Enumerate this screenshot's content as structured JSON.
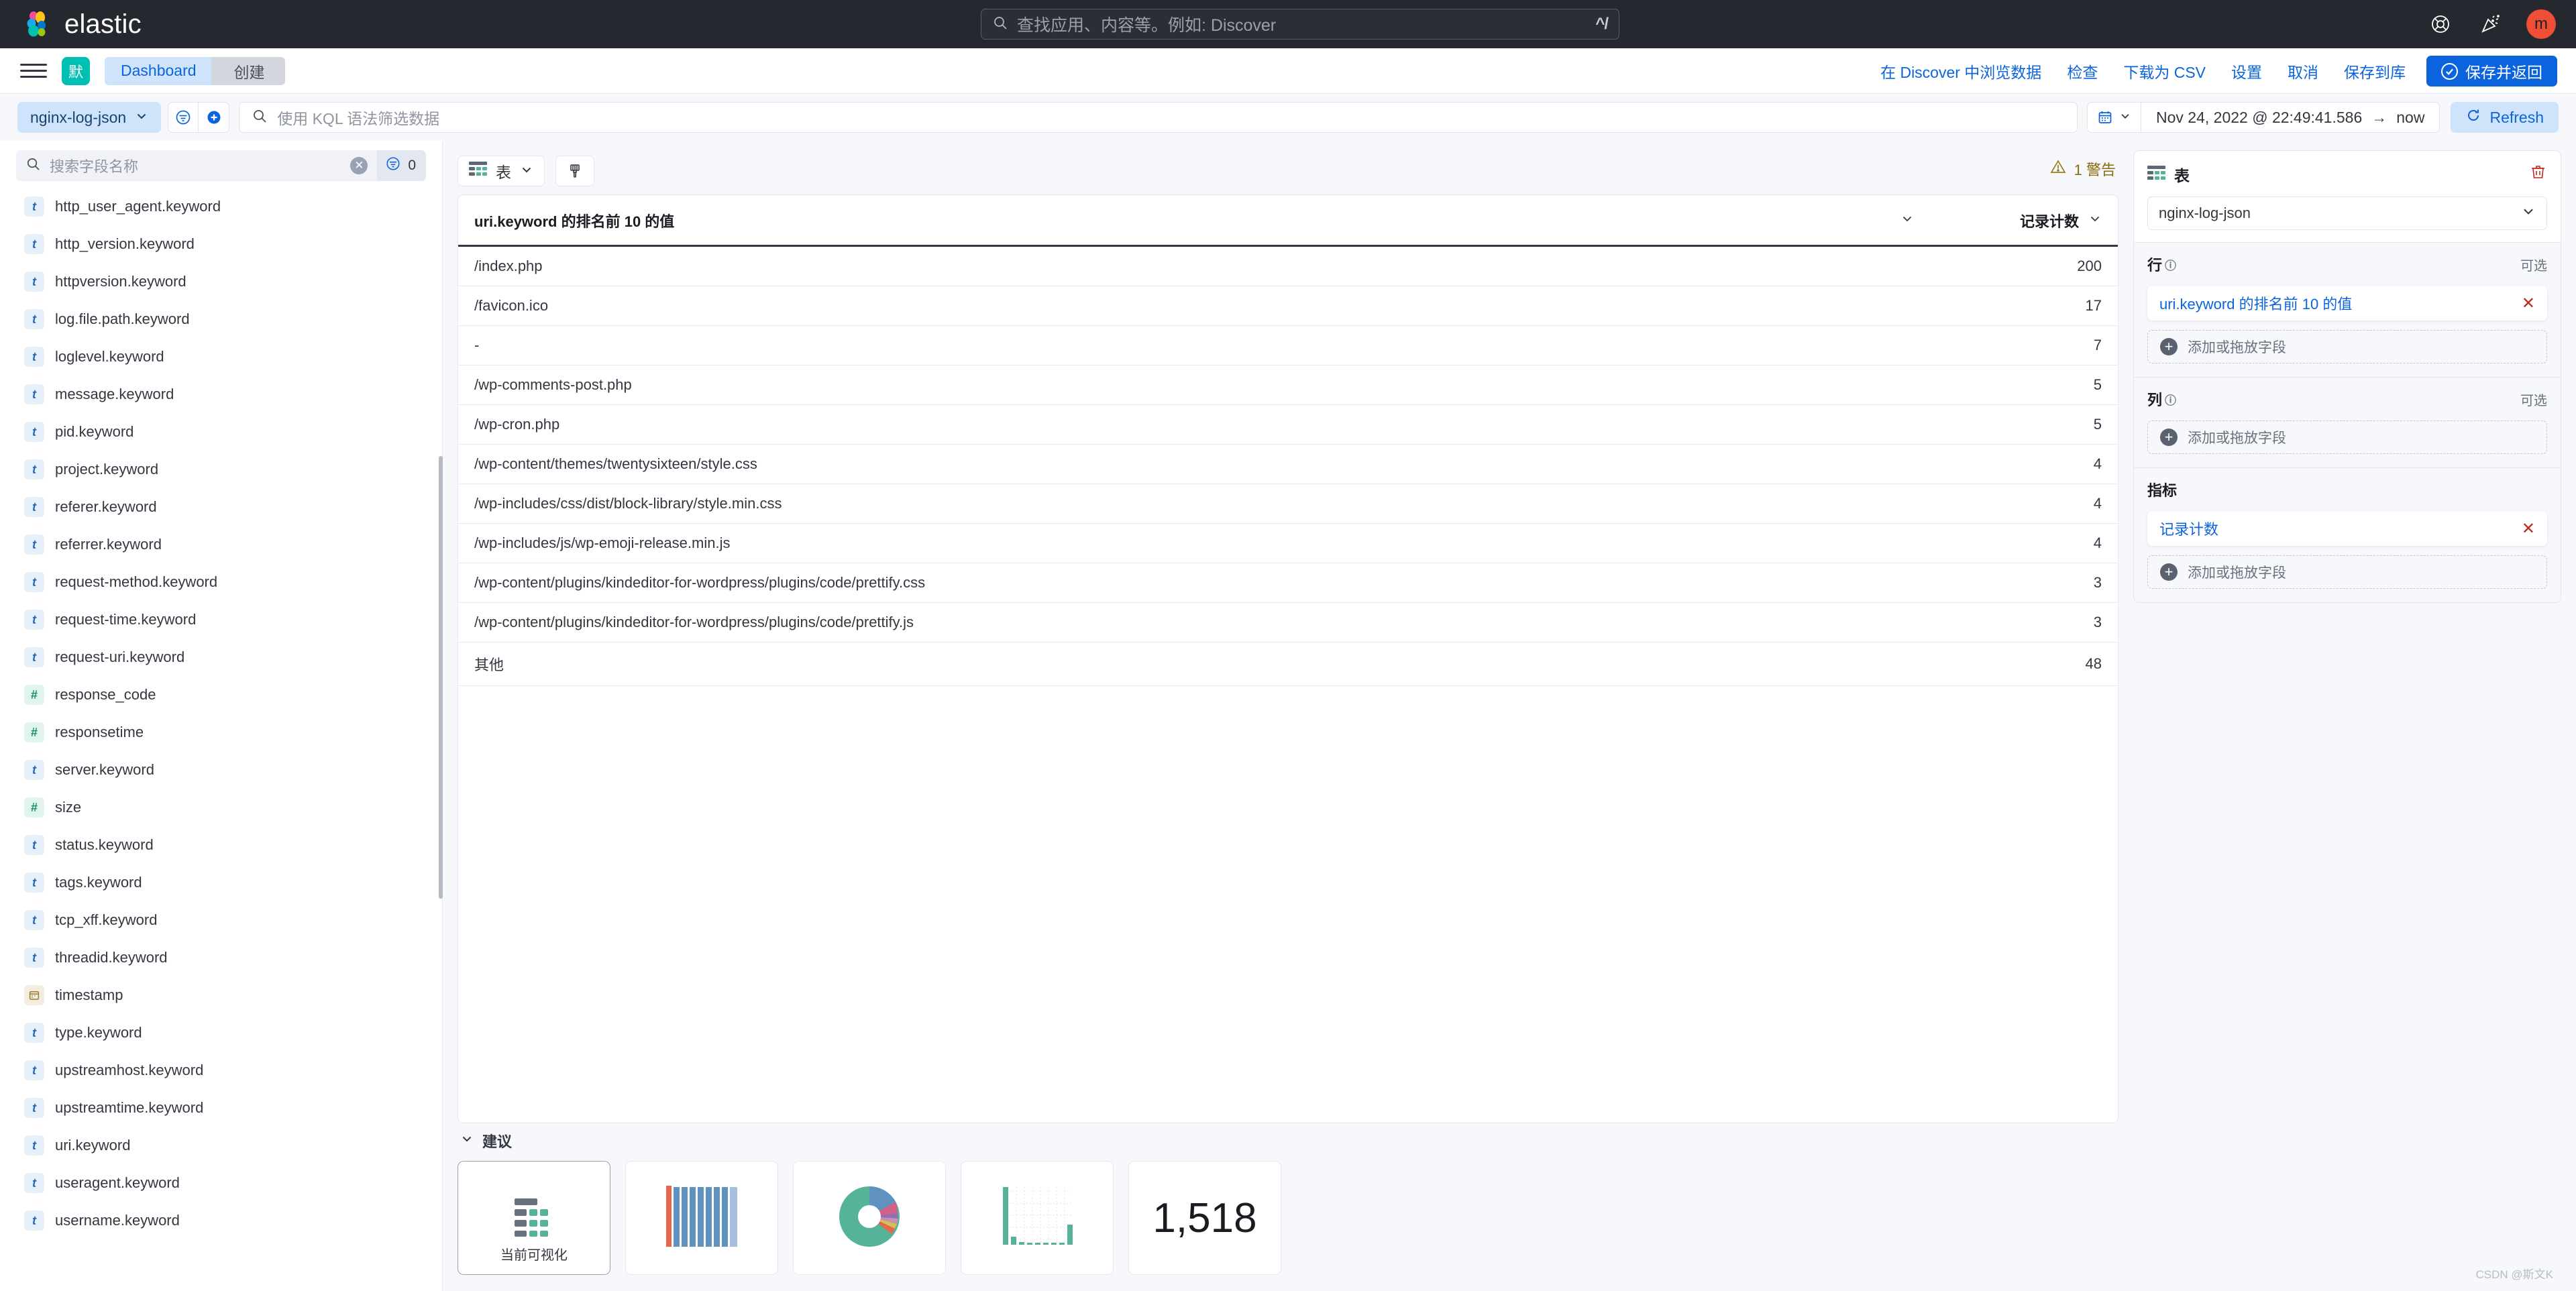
{
  "header": {
    "brand": "elastic",
    "search": {
      "placeholder": "查找应用、内容等。例如: Discover",
      "shortcut": "^/",
      "icon": "search-icon"
    },
    "help_icon": "lifebuoy-icon",
    "whatsnew_icon": "confetti-icon",
    "avatar_initial": "m"
  },
  "breadcrumb": {
    "menu_icon": "hamburger-menu-icon",
    "space_initial": "默",
    "items": [
      {
        "label": "Dashboard"
      },
      {
        "label": "创建"
      }
    ],
    "actions": [
      {
        "label": "在 Discover 中浏览数据"
      },
      {
        "label": "检查"
      },
      {
        "label": "下载为 CSV"
      },
      {
        "label": "设置"
      },
      {
        "label": "取消"
      },
      {
        "label": "保存到库"
      }
    ],
    "primary_action": "保存并返回"
  },
  "query_bar": {
    "datasource": "nginx-log-json",
    "filter_icon": "filter-icon",
    "add_filter_icon": "add-filter-icon",
    "kql_placeholder": "使用 KQL 语法筛选数据",
    "calendar_icon": "calendar-icon",
    "date_from": "Nov 24, 2022 @ 22:49:41.586",
    "date_arrow": "→",
    "date_to": "now",
    "refresh_label": "Refresh"
  },
  "sidebar": {
    "search_placeholder": "搜索字段名称",
    "clear_icon": "clear-circle-icon",
    "filter_icon": "field-filter-icon",
    "filter_count": "0",
    "fields": [
      {
        "name": "http_user_agent.keyword",
        "type": "t"
      },
      {
        "name": "http_version.keyword",
        "type": "t"
      },
      {
        "name": "httpversion.keyword",
        "type": "t"
      },
      {
        "name": "log.file.path.keyword",
        "type": "t"
      },
      {
        "name": "loglevel.keyword",
        "type": "t"
      },
      {
        "name": "message.keyword",
        "type": "t"
      },
      {
        "name": "pid.keyword",
        "type": "t"
      },
      {
        "name": "project.keyword",
        "type": "t"
      },
      {
        "name": "referer.keyword",
        "type": "t"
      },
      {
        "name": "referrer.keyword",
        "type": "t"
      },
      {
        "name": "request-method.keyword",
        "type": "t"
      },
      {
        "name": "request-time.keyword",
        "type": "t"
      },
      {
        "name": "request-uri.keyword",
        "type": "t"
      },
      {
        "name": "response_code",
        "type": "n"
      },
      {
        "name": "responsetime",
        "type": "n"
      },
      {
        "name": "server.keyword",
        "type": "t"
      },
      {
        "name": "size",
        "type": "n"
      },
      {
        "name": "status.keyword",
        "type": "t"
      },
      {
        "name": "tags.keyword",
        "type": "t"
      },
      {
        "name": "tcp_xff.keyword",
        "type": "t"
      },
      {
        "name": "threadid.keyword",
        "type": "t"
      },
      {
        "name": "timestamp",
        "type": "d"
      },
      {
        "name": "type.keyword",
        "type": "t"
      },
      {
        "name": "upstreamhost.keyword",
        "type": "t"
      },
      {
        "name": "upstreamtime.keyword",
        "type": "t"
      },
      {
        "name": "uri.keyword",
        "type": "t"
      },
      {
        "name": "useragent.keyword",
        "type": "t"
      },
      {
        "name": "username.keyword",
        "type": "t"
      }
    ]
  },
  "chart_toolbar": {
    "vis_type_label": "表",
    "vis_type_icon": "table-icon",
    "style_icon": "paintbrush-icon",
    "warning_icon": "warning-triangle-icon",
    "warning_label": "1 警告"
  },
  "chart_data": {
    "type": "table",
    "title": "",
    "columns": [
      "uri.keyword 的排名前 10 的值",
      "记录计数"
    ],
    "categories": [
      "/index.php",
      "/favicon.ico",
      "-",
      "/wp-comments-post.php",
      "/wp-cron.php",
      "/wp-content/themes/twentysixteen/style.css",
      "/wp-includes/css/dist/block-library/style.min.css",
      "/wp-includes/js/wp-emoji-release.min.js",
      "/wp-content/plugins/kindeditor-for-wordpress/plugins/code/prettify.css",
      "/wp-content/plugins/kindeditor-for-wordpress/plugins/code/prettify.js",
      "其他"
    ],
    "values": [
      200,
      17,
      7,
      5,
      5,
      4,
      4,
      4,
      3,
      3,
      48
    ],
    "xlabel": "uri.keyword 的排名前 10 的值",
    "ylabel": "记录计数"
  },
  "suggestions": {
    "section_label": "建议",
    "collapse_icon": "chevron-down-icon",
    "cards": [
      {
        "icon": "table-chart-icon",
        "label": "当前可视化"
      },
      {
        "icon": "bar-chart-icon",
        "label": ""
      },
      {
        "icon": "donut-chart-icon",
        "label": ""
      },
      {
        "icon": "histogram-chart-icon",
        "label": ""
      },
      {
        "icon": "metric-icon",
        "label": "1,518"
      }
    ]
  },
  "config_panel": {
    "title": "表",
    "title_icon": "table-icon",
    "trash_icon": "trash-icon",
    "datasource": "nginx-log-json",
    "sections": [
      {
        "title": "行",
        "has_help": true,
        "optional_label": "可选",
        "pills": [
          {
            "label": "uri.keyword 的排名前 10 的值"
          }
        ],
        "drop_label": "添加或拖放字段"
      },
      {
        "title": "列",
        "has_help": true,
        "optional_label": "可选",
        "pills": [],
        "drop_label": "添加或拖放字段"
      },
      {
        "title": "指标",
        "has_help": false,
        "optional_label": "",
        "pills": [
          {
            "label": "记录计数"
          }
        ],
        "drop_label": "添加或拖放字段"
      }
    ]
  },
  "watermark": "CSDN @斯文K"
}
